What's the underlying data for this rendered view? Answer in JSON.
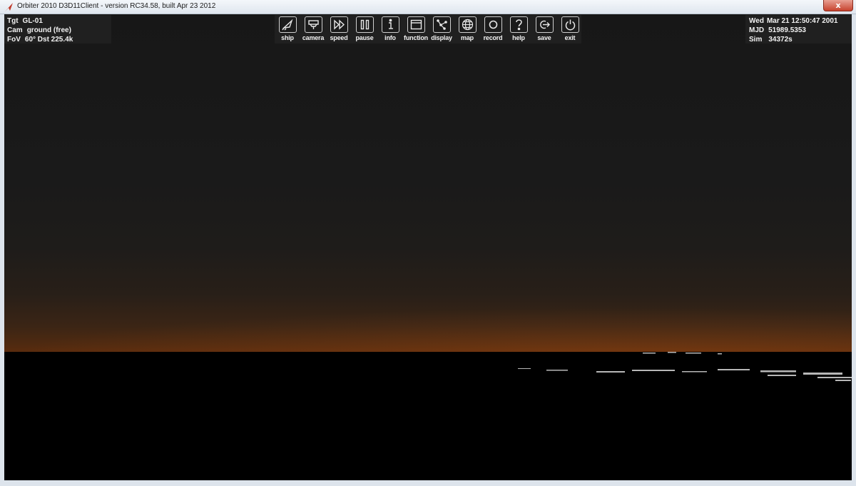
{
  "window": {
    "title": "Orbiter 2010 D3D11Client - version RC34.58, built Apr 23 2012",
    "close_glyph": "x"
  },
  "hud_left": {
    "rows": [
      {
        "key": "Tgt",
        "value": "GL-01"
      },
      {
        "key": "Cam",
        "value": "ground (free)"
      },
      {
        "key": "FoV",
        "value": "60°   Dst 225.4k"
      }
    ]
  },
  "hud_right": {
    "rows": [
      {
        "key": "Wed",
        "value": "Mar 21 12:50:47 2001"
      },
      {
        "key": "MJD",
        "value": "51989.5353"
      },
      {
        "key": "Sim",
        "value": "34372s"
      }
    ]
  },
  "toolbar": {
    "buttons": [
      {
        "label": "ship",
        "icon": "ship-icon"
      },
      {
        "label": "camera",
        "icon": "camera-icon"
      },
      {
        "label": "speed",
        "icon": "speed-icon"
      },
      {
        "label": "pause",
        "icon": "pause-icon"
      },
      {
        "label": "info",
        "icon": "info-icon"
      },
      {
        "label": "function",
        "icon": "function-icon"
      },
      {
        "label": "display",
        "icon": "display-icon"
      },
      {
        "label": "map",
        "icon": "map-icon"
      },
      {
        "label": "record",
        "icon": "record-icon"
      },
      {
        "label": "help",
        "icon": "help-icon"
      },
      {
        "label": "save",
        "icon": "save-icon"
      },
      {
        "label": "exit",
        "icon": "exit-icon"
      }
    ]
  },
  "colors": {
    "sky_top": "#171717",
    "horizon": "#5e2c0d",
    "ground": "#000000",
    "hud_text": "#f2f2f2"
  }
}
